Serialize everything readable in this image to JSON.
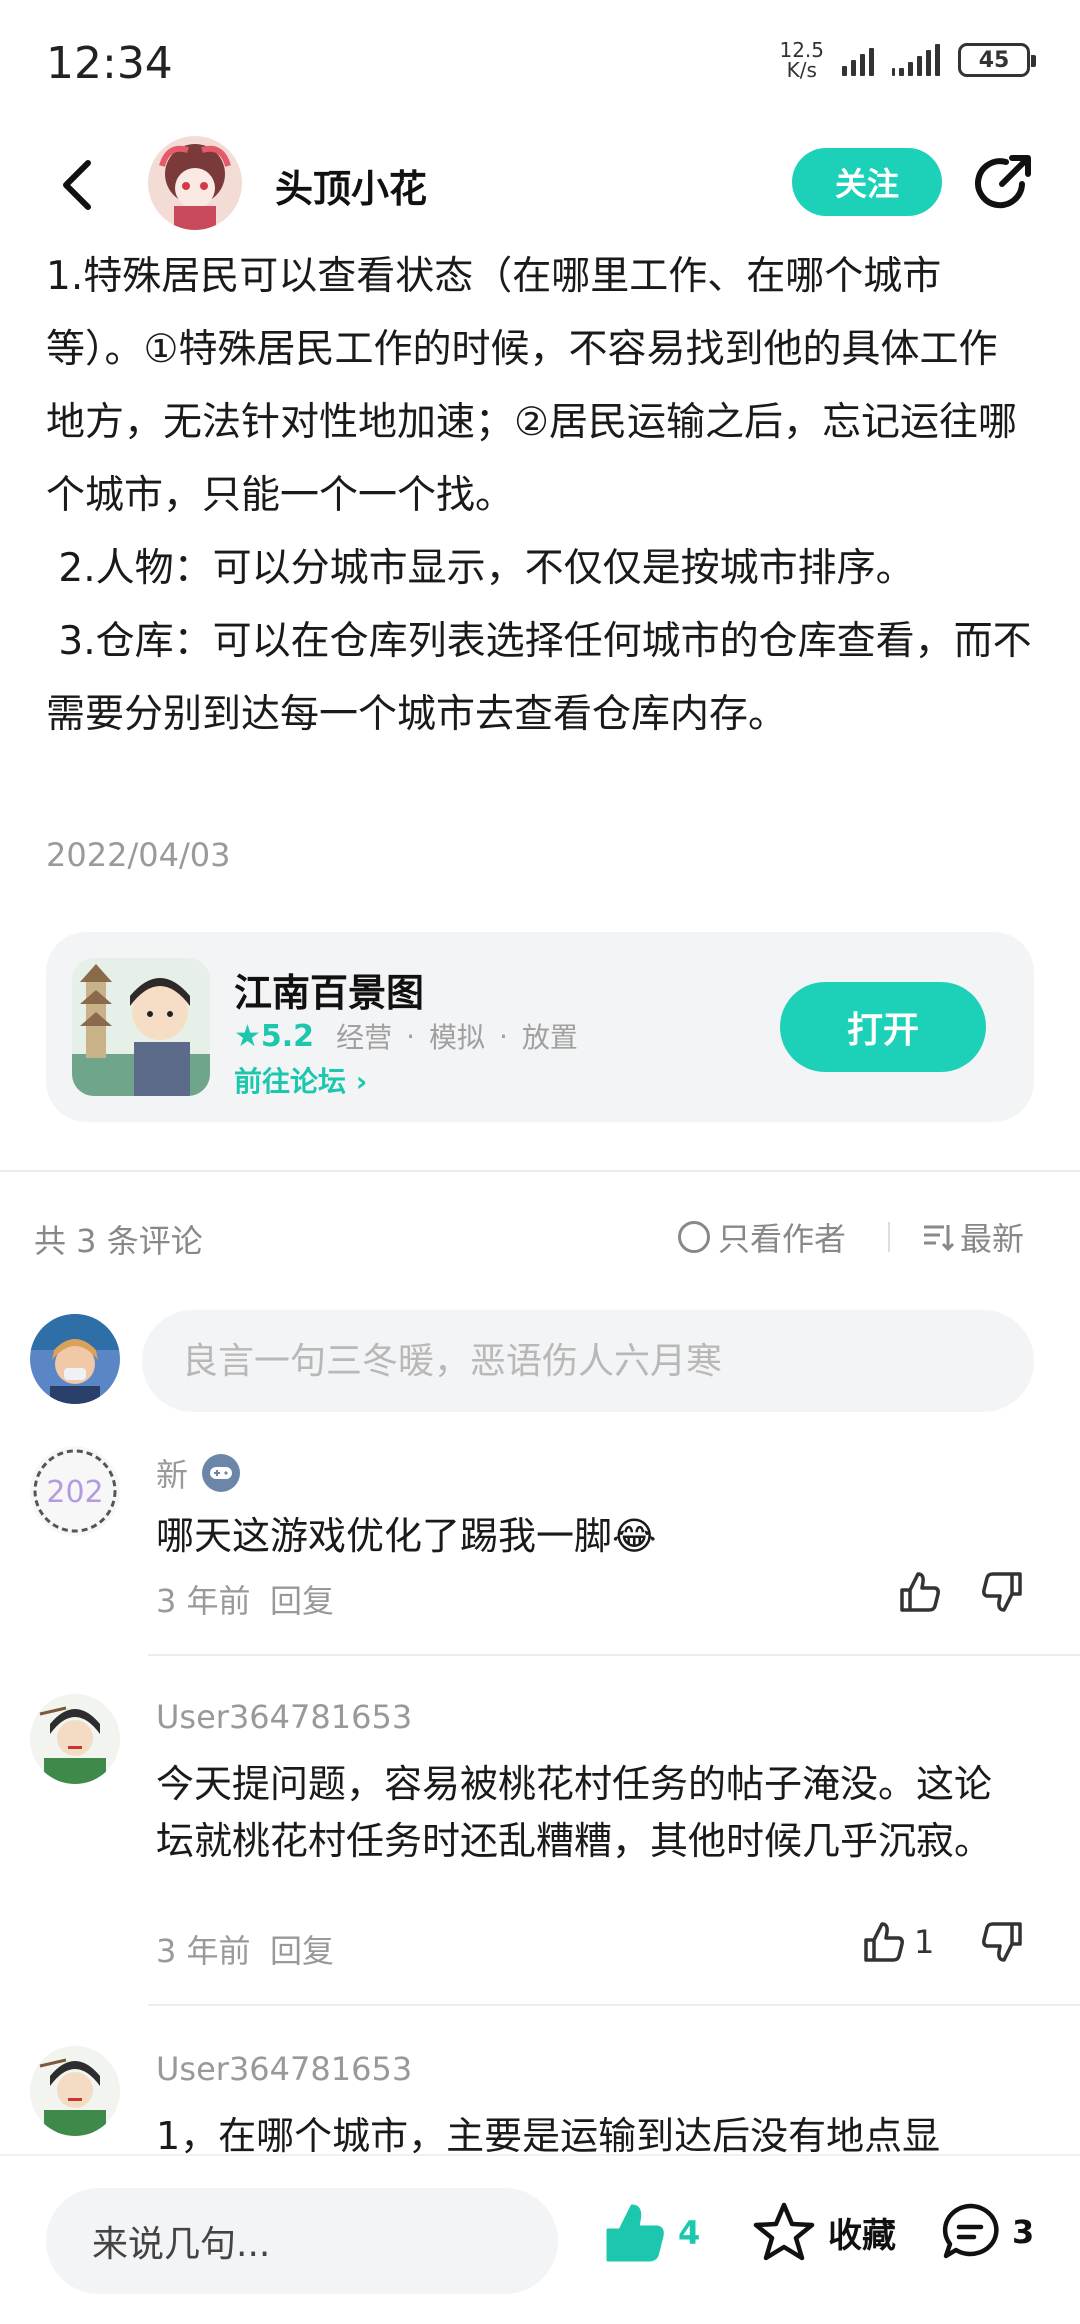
{
  "status_bar": {
    "time": "12:34",
    "net_speed_value": "12.5",
    "net_speed_unit": "K/s",
    "battery": "45"
  },
  "header": {
    "author_name": "头顶小花",
    "follow_label": "关注"
  },
  "post": {
    "paragraphs": [
      "1.特殊居民可以查看状态（在哪里工作、在哪个城市等）。①特殊居民工作的时候，不容易找到他的具体工作地方，无法针对性地加速；②居民运输之后，忘记运往哪个城市，只能一个一个找。",
      " 2.人物：可以分城市显示，不仅仅是按城市排序。",
      " 3.仓库：可以在仓库列表选择任何城市的仓库查看，而不需要分别到达每一个城市去查看仓库内存。"
    ],
    "date": "2022/04/03"
  },
  "app_card": {
    "name": "江南百景图",
    "rating": "5.2",
    "tags": [
      "经营",
      "模拟",
      "放置"
    ],
    "forum_link": "前往论坛",
    "open_label": "打开"
  },
  "comments_header": {
    "count_label": "共 3 条评论",
    "author_only_label": "只看作者",
    "sort_label": "最新"
  },
  "comment_input": {
    "placeholder": "良言一句三冬暖，恶语伤人六月寒"
  },
  "comments": [
    {
      "user": "新",
      "avatar_text": "202",
      "text": "哪天这游戏优化了踢我一脚😂",
      "time": "3 年前",
      "reply_label": "回复",
      "likes": ""
    },
    {
      "user": "User364781653",
      "text": "今天提问题，容易被桃花村任务的帖子淹没。这论坛就桃花村任务时还乱糟糟，其他时候几乎沉寂。",
      "time": "3 年前",
      "reply_label": "回复",
      "likes": "1"
    },
    {
      "user": "User364781653",
      "text": "1，在哪个城市，主要是运输到达后没有地点显",
      "time": "",
      "reply_label": "",
      "likes": ""
    }
  ],
  "bottom_bar": {
    "input_label": "来说几句...",
    "like_count": "4",
    "favorite_label": "收藏",
    "comment_count": "3"
  },
  "colors": {
    "accent": "#1dd1b8",
    "accent_text": "#1dc7ad",
    "muted_text": "#999999",
    "panel_bg": "#f3f4f6"
  },
  "icons": {
    "back": "chevron-left-icon",
    "share": "share-icon",
    "star": "star-icon",
    "chevron": "chevron-right-icon",
    "like": "thumbs-up-icon",
    "dislike": "thumbs-down-icon",
    "favorite": "star-outline-icon",
    "comment": "chat-bubble-icon",
    "sort": "sort-icon",
    "gamepad": "gamepad-icon"
  }
}
